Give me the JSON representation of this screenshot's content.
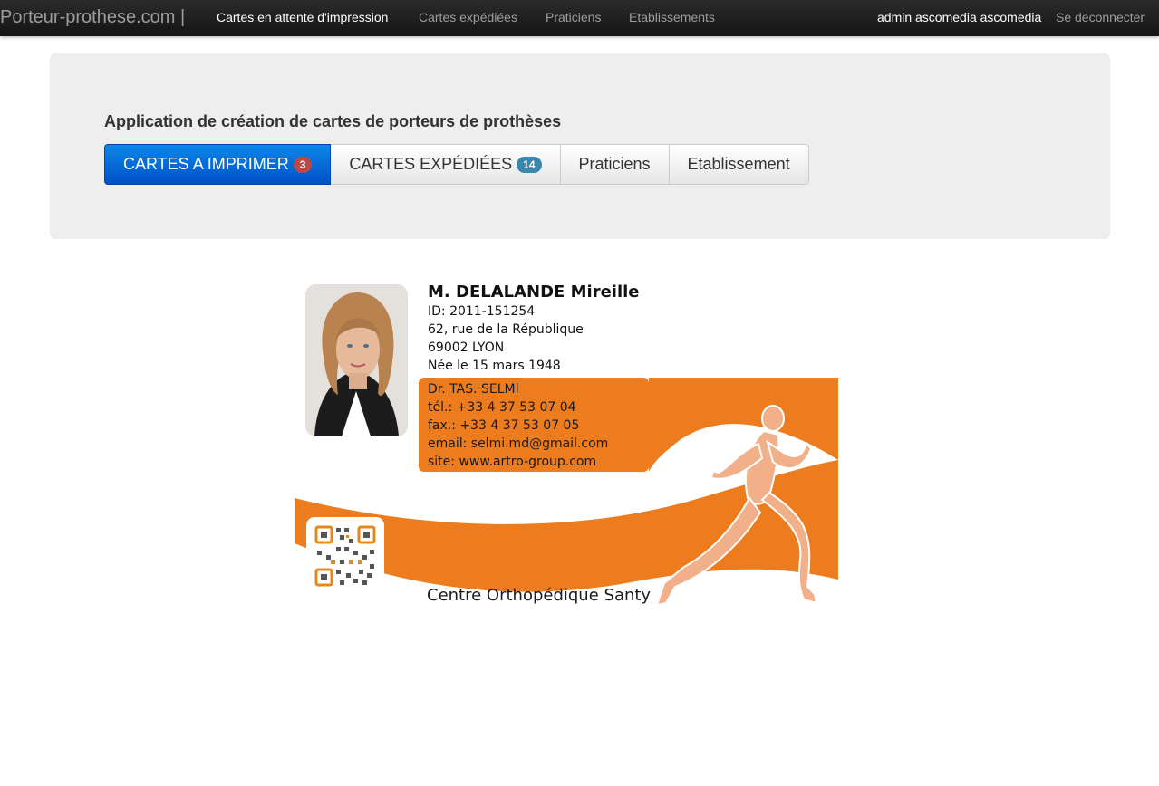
{
  "navbar": {
    "brand": "Porteur-prothese.com |",
    "links": [
      {
        "label": "Cartes en attente d'impression",
        "active": true
      },
      {
        "label": "Cartes expédiées",
        "active": false
      },
      {
        "label": "Praticiens",
        "active": false
      },
      {
        "label": "Etablissements",
        "active": false
      }
    ],
    "user": "admin ascomedia ascomedia",
    "logout": "Se deconnecter"
  },
  "hero": {
    "title": "Application de création de cartes de porteurs de prothèses",
    "buttons": [
      {
        "label": "CARTES A IMPRIMER",
        "badge": "3",
        "badge_color": "#b94a48"
      },
      {
        "label": "CARTES EXPÉDIÉES",
        "badge": "14",
        "badge_color": "#3a87ad"
      },
      {
        "label": "Praticiens"
      },
      {
        "label": "Etablissement"
      }
    ]
  },
  "card": {
    "patient": {
      "name": "M. DELALANDE Mireille",
      "id": "ID: 2011-151254",
      "address": "62, rue de la République",
      "city": "69002 LYON",
      "birth": "Née le 15 mars 1948"
    },
    "doctor": {
      "name": "Dr. TAS. SELMI",
      "tel": "tél.: +33 4 37 53 07 04",
      "fax": "fax.: +33 4 37 53 07 05",
      "email": "email: selmi.md@gmail.com",
      "site": "site: www.artro-group.com"
    },
    "center": "Centre Orthopédique Santy",
    "accent_color": "#ec7c1e"
  }
}
